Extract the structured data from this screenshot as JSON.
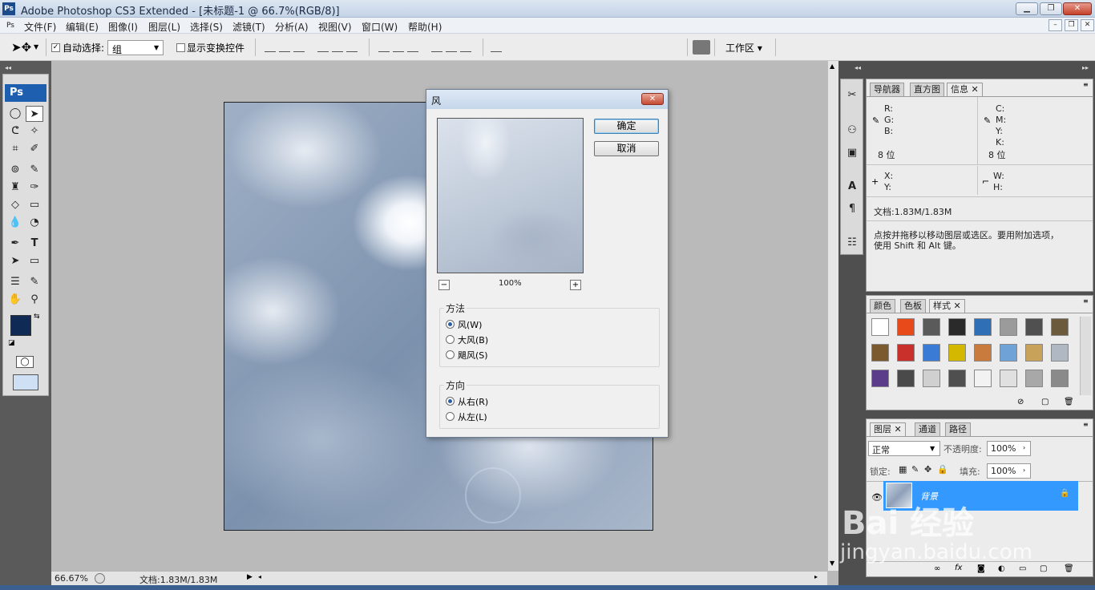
{
  "app": {
    "title": "Adobe Photoshop CS3 Extended - [未标题-1 @ 66.7%(RGB/8)]",
    "icon_text": "Ps"
  },
  "menu": [
    "文件(F)",
    "编辑(E)",
    "图像(I)",
    "图层(L)",
    "选择(S)",
    "滤镜(T)",
    "分析(A)",
    "视图(V)",
    "窗口(W)",
    "帮助(H)"
  ],
  "options": {
    "auto_select_label": "自动选择:",
    "auto_select_value": "组",
    "show_transform_label": "显示变换控件",
    "workspace_label": "工作区 ▾"
  },
  "toolbox": {
    "logo": "Ps",
    "foreground_color": "#0f2a55",
    "background_color": "#ffffff"
  },
  "status": {
    "zoom": "66.67%",
    "doc": "文档:1.83M/1.83M"
  },
  "dialog": {
    "title": "风",
    "ok": "确定",
    "cancel": "取消",
    "zoom_minus": "−",
    "zoom_value": "100%",
    "zoom_plus": "+",
    "method_label": "方法",
    "methods": [
      {
        "label": "风(W)",
        "selected": true
      },
      {
        "label": "大风(B)",
        "selected": false
      },
      {
        "label": "飓风(S)",
        "selected": false
      }
    ],
    "direction_label": "方向",
    "directions": [
      {
        "label": "从右(R)",
        "selected": true
      },
      {
        "label": "从左(L)",
        "selected": false
      }
    ]
  },
  "info_panel": {
    "tabs": [
      "导航器",
      "直方图",
      "信息"
    ],
    "rgb_labels": [
      "R:",
      "G:",
      "B:"
    ],
    "cmyk_labels": [
      "C:",
      "M:",
      "Y:",
      "K:"
    ],
    "bits_left": "8 位",
    "bits_right": "8 位",
    "xy_labels": [
      "X:",
      "Y:"
    ],
    "wh_labels": [
      "W:",
      "H:"
    ],
    "doc": "文档:1.83M/1.83M",
    "hint_line1": "点按并拖移以移动图层或选区。要用附加选项，",
    "hint_line2": "使用 Shift 和 Alt 键。"
  },
  "styles_panel": {
    "tabs": [
      "颜色",
      "色板",
      "样式"
    ],
    "swatch_colors": [
      "#ffffff",
      "#e84a1a",
      "#5a5a5a",
      "#2a2a2a",
      "#2f6fb5",
      "#9b9b9b",
      "#505050",
      "#6b5a3c",
      "#7a5a2e",
      "#c9302c",
      "#3a7bd5",
      "#d4b800",
      "#c97a3d",
      "#6fa3d8",
      "#c9a25a",
      "#b0b8c4",
      "#5a3c8a",
      "#4a4a4a",
      "#d0d0d0",
      "#4f4f4f",
      "#f2f2f2",
      "#e0e0e0",
      "#a8a8a8",
      "#8a8a8a"
    ]
  },
  "layers_panel": {
    "tabs": [
      "图层",
      "通道",
      "路径"
    ],
    "blend_mode": "正常",
    "opacity_label": "不透明度:",
    "opacity_value": "100%",
    "lock_label": "锁定:",
    "fill_label": "填充:",
    "fill_value": "100%",
    "layer_name": "背景"
  },
  "watermark": {
    "brand": "Bai 经验",
    "url": "jingyan.baidu.com"
  }
}
